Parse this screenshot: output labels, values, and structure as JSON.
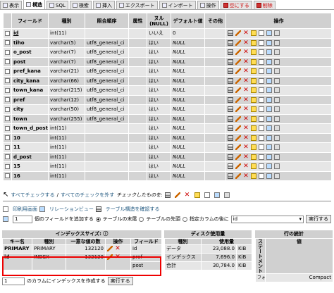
{
  "tabs": [
    {
      "label": "表示",
      "icon": "browse-icon",
      "active": false
    },
    {
      "label": "構造",
      "icon": "structure-icon",
      "active": true
    },
    {
      "label": "SQL",
      "icon": "sql-icon",
      "active": false
    },
    {
      "label": "検索",
      "icon": "search-icon",
      "active": false
    },
    {
      "label": "挿入",
      "icon": "insert-icon",
      "active": false
    },
    {
      "label": "エクスポート",
      "icon": "export-icon",
      "active": false
    },
    {
      "label": "インポート",
      "icon": "import-icon",
      "active": false
    },
    {
      "label": "操作",
      "icon": "operations-icon",
      "active": false
    },
    {
      "label": "空にする",
      "icon": "empty-icon",
      "active": false
    },
    {
      "label": "削除",
      "icon": "drop-icon",
      "active": false
    }
  ],
  "structure": {
    "headers": {
      "field": "フィールド",
      "type": "種別",
      "collation": "照合順序",
      "attributes": "属性",
      "null": "ヌル (NULL)",
      "default": "デフォルト値",
      "extra": "その他",
      "action": "操作"
    },
    "rows": [
      {
        "field": "id",
        "type": "int(11)",
        "collation": "",
        "null": "いいえ",
        "default": "0",
        "primary": true
      },
      {
        "field": "tiho",
        "type": "varchar(5)",
        "collation": "utf8_general_ci",
        "null": "はい",
        "default": "NULL"
      },
      {
        "field": "o_post",
        "type": "varchar(7)",
        "collation": "utf8_general_ci",
        "null": "はい",
        "default": "NULL"
      },
      {
        "field": "post",
        "type": "varchar(7)",
        "collation": "utf8_general_ci",
        "null": "はい",
        "default": "NULL"
      },
      {
        "field": "pref_kana",
        "type": "varchar(21)",
        "collation": "utf8_general_ci",
        "null": "はい",
        "default": "NULL"
      },
      {
        "field": "city_kana",
        "type": "varchar(66)",
        "collation": "utf8_general_ci",
        "null": "はい",
        "default": "NULL"
      },
      {
        "field": "town_kana",
        "type": "varchar(215)",
        "collation": "utf8_general_ci",
        "null": "はい",
        "default": "NULL"
      },
      {
        "field": "pref",
        "type": "varchar(12)",
        "collation": "utf8_general_ci",
        "null": "はい",
        "default": "NULL"
      },
      {
        "field": "city",
        "type": "varchar(50)",
        "collation": "utf8_general_ci",
        "null": "はい",
        "default": "NULL"
      },
      {
        "field": "town",
        "type": "varchar(255)",
        "collation": "utf8_general_ci",
        "null": "はい",
        "default": "NULL"
      },
      {
        "field": "town_d_post",
        "type": "int(11)",
        "collation": "",
        "null": "はい",
        "default": "NULL"
      },
      {
        "field": "10",
        "type": "int(11)",
        "collation": "",
        "null": "はい",
        "default": "NULL"
      },
      {
        "field": "11",
        "type": "int(11)",
        "collation": "",
        "null": "はい",
        "default": "NULL"
      },
      {
        "field": "d_post",
        "type": "int(11)",
        "collation": "",
        "null": "はい",
        "default": "NULL"
      },
      {
        "field": "15",
        "type": "int(11)",
        "collation": "",
        "null": "はい",
        "default": "NULL"
      },
      {
        "field": "16",
        "type": "int(11)",
        "collation": "",
        "null": "はい",
        "default": "NULL"
      }
    ]
  },
  "check_line": {
    "check_all": "すべてチェックする",
    "separator": " / ",
    "uncheck_all": "すべてのチェックを外す",
    "with_selected": "チェックしたものを:"
  },
  "print_line": {
    "print_view": "印刷用画面",
    "relation_view": "リレーションビュー",
    "propose_structure": "テーブル構造を確認する"
  },
  "add_line": {
    "count": "1",
    "label": "個のフィールドを追加する",
    "opt_end": "テーブルの末尾",
    "opt_begin": "テーブルの先頭",
    "opt_after": "指定カラムの後に",
    "after_field": "id",
    "submit": "実行する"
  },
  "indexes": {
    "title": "インデックスサイズ:",
    "headers": {
      "keyname": "キー名",
      "type": "種別",
      "cardinality": "一意な値の数",
      "action": "操作",
      "field": "フィールド"
    },
    "rows": [
      {
        "keyname": "PRIMARY",
        "type": "PRIMARY",
        "cardinality": "132120",
        "fields": [
          "id"
        ]
      },
      {
        "keyname": "id",
        "type": "INDEX",
        "cardinality": "132120",
        "fields": [
          "pref",
          "post"
        ]
      }
    ],
    "footer": {
      "count": "1",
      "label": "のカラムにインデックスを作成する",
      "submit": "実行する"
    }
  },
  "disk": {
    "title": "ディスク使用量",
    "headers": {
      "type": "種別",
      "usage": "使用量"
    },
    "rows": [
      {
        "type": "データ",
        "value": "23,088.0",
        "unit": "KiB"
      },
      {
        "type": "インデックス",
        "value": "7,696.0",
        "unit": "KiB"
      },
      {
        "type": "合計",
        "value": "30,784.0",
        "unit": "KiB"
      }
    ]
  },
  "stats": {
    "title": "行の統計",
    "headers": {
      "statement": "ステートメント",
      "value": "値"
    },
    "rows": [
      {
        "statement": "フォ",
        "value": "Compact"
      }
    ]
  }
}
